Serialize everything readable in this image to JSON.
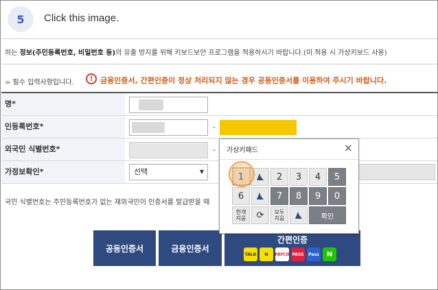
{
  "step": {
    "number": "5",
    "instruction": "Click this image."
  },
  "notice": {
    "prefix": "하는 ",
    "bold": "정보(주민등록번호, 비밀번호 등)",
    "rest": "의 유출 방지를 위해 키보드보안 프로그램을 적용하시기 바랍니다.(미 적용 시 가상키보드 사용)"
  },
  "required_note": "= 필수 입력사항입니다.",
  "warning": {
    "icon": "!",
    "text": "금융인증서, 간편인증이 정상 처리되지 않는 경우 공동인증서를 이용하여 주시기 바랍니다."
  },
  "form": {
    "rows": [
      {
        "label": "명",
        "star": "*"
      },
      {
        "label": "인등록번호",
        "star": "*",
        "dash": "-"
      },
      {
        "label": "외국민 식별번호",
        "star": "*",
        "dash": "-"
      },
      {
        "label": "가정보확인",
        "star": "*",
        "select": "선택"
      }
    ]
  },
  "foot_note": "국민 식별번호는 주민등록번호가 없는 재외국민이 인증서를 발급받을 때",
  "buttons": {
    "joint_cert": "공동인증서",
    "financial_cert": "금융인증서",
    "simple_auth": "간편인증",
    "logos": [
      "TALK",
      "N",
      "PAYCO",
      "PASS",
      "Pass",
      "N"
    ]
  },
  "keypad": {
    "title": "가상키패드",
    "close": "×",
    "row1": [
      "1",
      "",
      "2",
      "3",
      "4",
      "5"
    ],
    "row2": [
      "6",
      "",
      "7",
      "8",
      "9",
      "0"
    ],
    "clear_all": "한개\n지움",
    "clear_all_l1": "한개",
    "clear_all_l2": "지움",
    "clear_all2_l1": "모두",
    "clear_all2_l2": "지움",
    "confirm": "확인"
  },
  "colors": {
    "accent": "#2f4a80",
    "warning": "#d85a12",
    "highlight": "#f0a050",
    "yellow_field": "#f6c600"
  }
}
